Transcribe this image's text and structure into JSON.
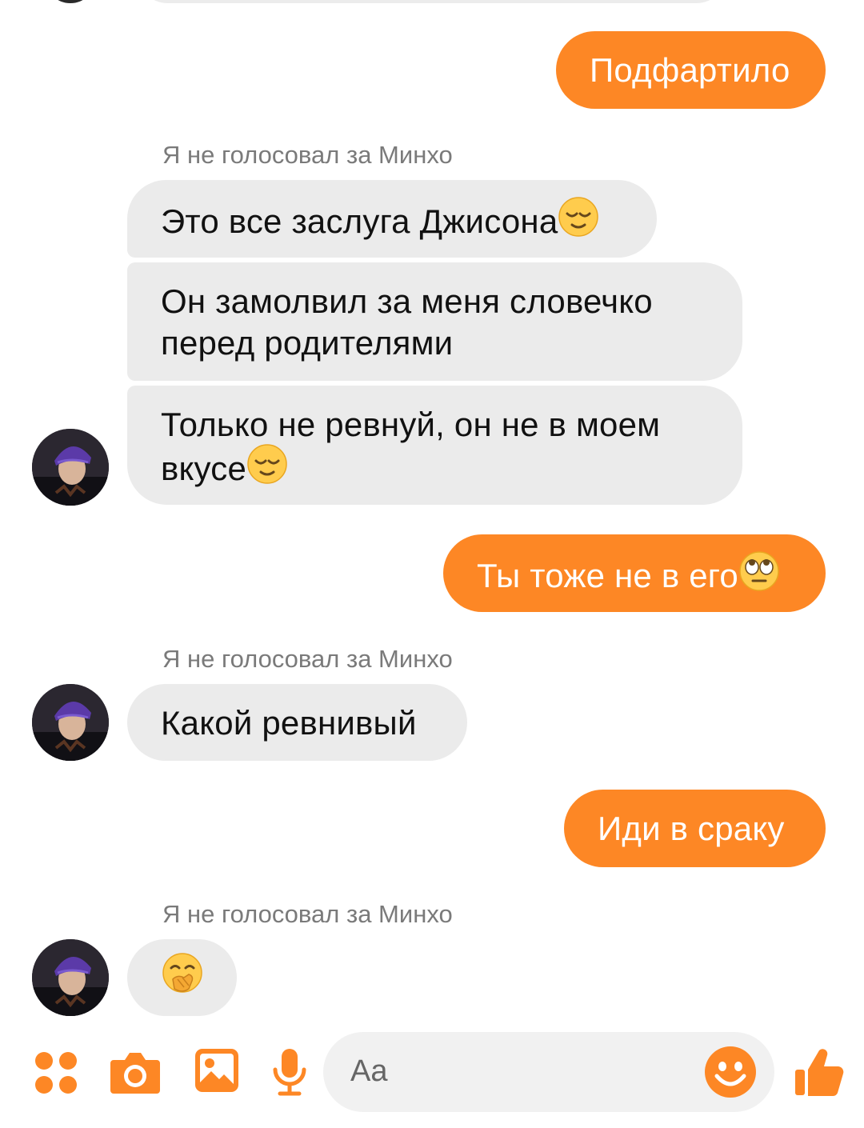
{
  "messages": {
    "m1": {
      "text": "Подфартило",
      "direction": "outgoing"
    },
    "sender1": "Я не голосовал за Минхо",
    "m2": {
      "text": "Это все заслуга Джисона",
      "emoji": "relieved-face",
      "direction": "incoming"
    },
    "m3": {
      "line1": "Он замолвил за меня словечко",
      "line2": "перед родителями",
      "direction": "incoming"
    },
    "m4": {
      "line1": "Только не ревнуй, он не в моем",
      "line2": "вкусе",
      "emoji": "relieved-face",
      "direction": "incoming"
    },
    "m5": {
      "text": "Ты тоже не в его",
      "emoji": "face-with-rolling-eyes",
      "direction": "outgoing"
    },
    "sender2": "Я не голосовал за Минхо",
    "m6": {
      "text": "Какой ревнивый",
      "direction": "incoming"
    },
    "m7": {
      "text": "Иди в сраку",
      "direction": "outgoing"
    },
    "sender3": "Я не голосовал за Минхо",
    "m8": {
      "emoji": "face-with-hand-over-mouth",
      "direction": "incoming"
    }
  },
  "composer": {
    "placeholder": "Aa",
    "icons": [
      "apps-icon",
      "camera-icon",
      "gallery-icon",
      "microphone-icon",
      "emoji-icon",
      "thumbs-up-icon"
    ]
  },
  "colors": {
    "outgoing_bubble": "#fd8725",
    "incoming_bubble": "#ebebeb",
    "accent": "#fd8725",
    "sender_label": "#7a7a7a"
  }
}
